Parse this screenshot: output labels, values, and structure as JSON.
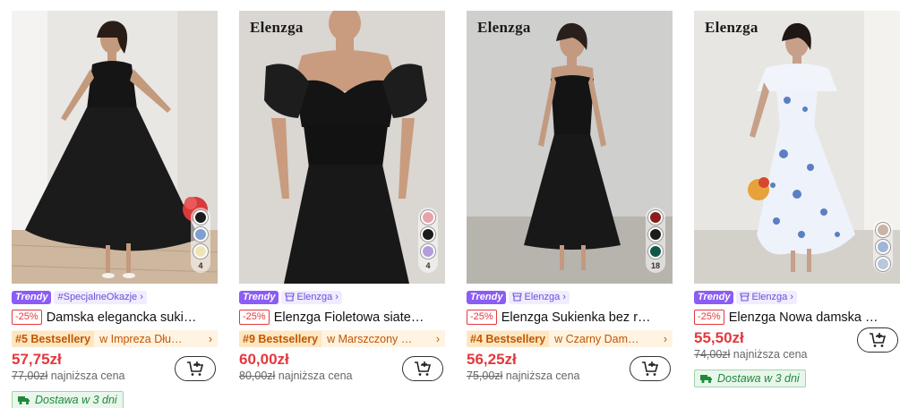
{
  "products": [
    {
      "brand_mark": "",
      "tag_trendy": "Trendy",
      "tag_text": "#SpecjalneOkazje",
      "tag_icon": "",
      "discount": "-25%",
      "title": "Damska elegancka suki…",
      "bestseller": "#5 Bestsellery",
      "bestseller_category": "w Impreza Dłu…",
      "price": "57,75zł",
      "old_price": "77,00zł",
      "lowest_label": "najniższa cena",
      "delivery": "Dostawa w 3 dni",
      "swatch_colors": [
        "#1c1c1c",
        "#7f9fd0",
        "#f0e3b4"
      ],
      "swatch_count": "4"
    },
    {
      "brand_mark": "Elenzga",
      "tag_trendy": "Trendy",
      "tag_text": "Elenzga",
      "tag_icon": "store-icon",
      "discount": "-25%",
      "title": "Elenzga Fioletowa siate…",
      "bestseller": "#9 Bestsellery",
      "bestseller_category": "w Marszczony …",
      "price": "60,00zł",
      "old_price": "80,00zł",
      "lowest_label": "najniższa cena",
      "delivery": "",
      "swatch_colors": [
        "#e8a3a8",
        "#1c1c1c",
        "#b39ddb"
      ],
      "swatch_count": "4"
    },
    {
      "brand_mark": "Elenzga",
      "tag_trendy": "Trendy",
      "tag_text": "Elenzga",
      "tag_icon": "store-icon",
      "discount": "-25%",
      "title": "Elenzga Sukienka bez r…",
      "bestseller": "#4 Bestsellery",
      "bestseller_category": "w Czarny Dam…",
      "price": "56,25zł",
      "old_price": "75,00zł",
      "lowest_label": "najniższa cena",
      "delivery": "",
      "swatch_colors": [
        "#8b1c1c",
        "#1c1c1c",
        "#0f5a47"
      ],
      "swatch_count": "18"
    },
    {
      "brand_mark": "Elenzga",
      "tag_trendy": "Trendy",
      "tag_text": "Elenzga",
      "tag_icon": "store-icon",
      "discount": "-25%",
      "title": "Elenzga Nowa damska …",
      "bestseller": "",
      "bestseller_category": "",
      "price": "55,50zł",
      "old_price": "74,00zł",
      "lowest_label": "najniższa cena",
      "delivery": "Dostawa w 3 dni",
      "swatch_colors": [
        "#c9b3a6",
        "#9fb6d6",
        "#b8c7db"
      ],
      "swatch_count": ""
    }
  ],
  "colors": {
    "price_red": "#e4383c",
    "trendy_purple": "#8b5cf6",
    "bestseller_orange": "#c35600",
    "delivery_green": "#1f8a3a"
  },
  "icons": {
    "cart": "add-to-cart-icon",
    "truck": "truck-icon",
    "chevron": "chevron-right-icon"
  }
}
